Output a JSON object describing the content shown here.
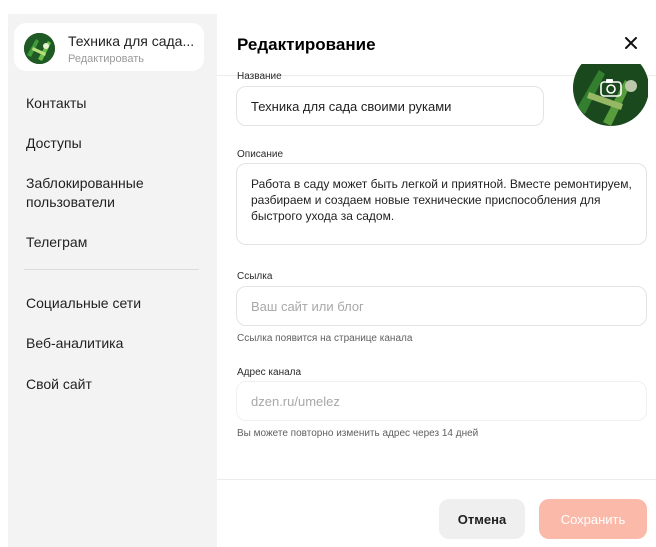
{
  "sidebar": {
    "channel": {
      "title": "Техника для сада...",
      "subtitle": "Редактировать"
    },
    "items": [
      {
        "label": "Контакты"
      },
      {
        "label": "Доступы"
      },
      {
        "label": "Заблокированные пользователи"
      },
      {
        "label": "Телеграм"
      },
      {
        "label": "Социальные сети"
      },
      {
        "label": "Веб-аналитика"
      },
      {
        "label": "Свой сайт"
      }
    ]
  },
  "main": {
    "title": "Редактирование",
    "close_icon": "close-icon",
    "name_label": "Название",
    "name_value": "Техника для сада своими руками",
    "description_label": "Описание",
    "description_value": "Работа в саду может быть легкой и приятной. Вместе ремонтируем, разбираем и создаем новые технические приспособления для быстрого ухода за садом.",
    "link_label": "Ссылка",
    "link_placeholder": "Ваш сайт или блог",
    "link_hint": "Ссылка появится на странице канала",
    "address_label": "Адрес канала",
    "address_value": "dzen.ru/umelez",
    "address_hint": "Вы можете повторно изменить адрес через 14 дней",
    "cancel_label": "Отмена",
    "save_label": "Сохранить"
  },
  "colors": {
    "sidebar_bg": "#f3f3f3",
    "save_button": "#fbb9a9",
    "cancel_button": "#efefef",
    "avatar_green": "#1f5a24"
  }
}
